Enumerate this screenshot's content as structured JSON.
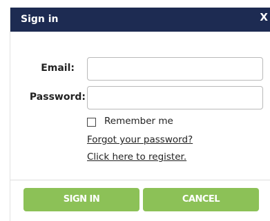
{
  "dialog": {
    "title": "Sign in",
    "close_label": "X"
  },
  "form": {
    "email_label": "Email:",
    "email_value": "",
    "password_label": "Password:",
    "password_value": "",
    "remember_label": "Remember me",
    "remember_checked": false,
    "forgot_link": "Forgot your password?",
    "register_link": "Click here to register."
  },
  "buttons": {
    "signin_label": "SIGN IN",
    "cancel_label": "CANCEL"
  },
  "colors": {
    "titlebar": "#1d2b52",
    "button": "#8cc157"
  }
}
